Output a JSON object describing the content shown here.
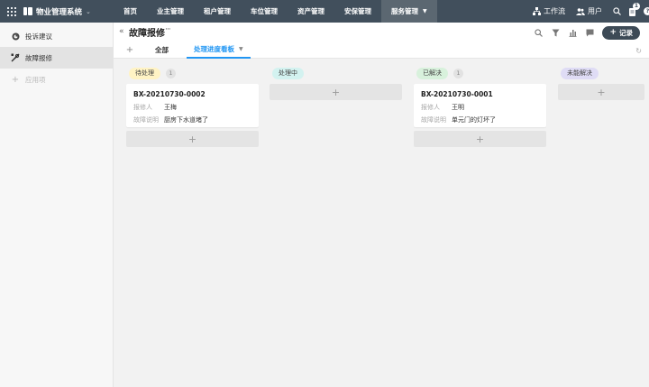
{
  "app": {
    "title": "物业管理系统"
  },
  "nav": {
    "items": [
      {
        "label": "首页"
      },
      {
        "label": "业主管理"
      },
      {
        "label": "租户管理"
      },
      {
        "label": "车位管理"
      },
      {
        "label": "资产管理"
      },
      {
        "label": "安保管理"
      },
      {
        "label": "服务管理"
      }
    ],
    "active": "服务管理"
  },
  "top_right": {
    "workflow_label": "工作流",
    "users_label": "用户",
    "notification_count": "1",
    "help": "?"
  },
  "sidebar": {
    "items": [
      {
        "label": "投诉建议"
      },
      {
        "label": "故障报修"
      }
    ],
    "add_label": "应用项"
  },
  "header": {
    "title": "故障报修",
    "more": "···",
    "record_button": "记录",
    "tabs": [
      {
        "label": "全部"
      },
      {
        "label": "处理进度看板"
      }
    ]
  },
  "board": {
    "columns": [
      {
        "status": "待处理",
        "count": "1",
        "color": "#fff3c4",
        "cards": [
          {
            "id": "BX-20210730-0002",
            "reporter_label": "报修人",
            "reporter": "王梅",
            "desc_label": "故障说明",
            "desc": "厨房下水道堵了"
          }
        ]
      },
      {
        "status": "处理中",
        "count": "",
        "color": "#d3f2f0",
        "cards": []
      },
      {
        "status": "已解决",
        "count": "1",
        "color": "#d8f1dc",
        "cards": [
          {
            "id": "BX-20210730-0001",
            "reporter_label": "报修人",
            "reporter": "王明",
            "desc_label": "故障说明",
            "desc": "单元门的灯坏了"
          }
        ]
      },
      {
        "status": "未能解决",
        "count": "",
        "color": "#dfdcf5",
        "cards": []
      }
    ],
    "add_symbol": "+"
  },
  "colors": {
    "topbar": "#414f5c",
    "accent": "#2196f3",
    "record_button": "#3d4a56"
  }
}
